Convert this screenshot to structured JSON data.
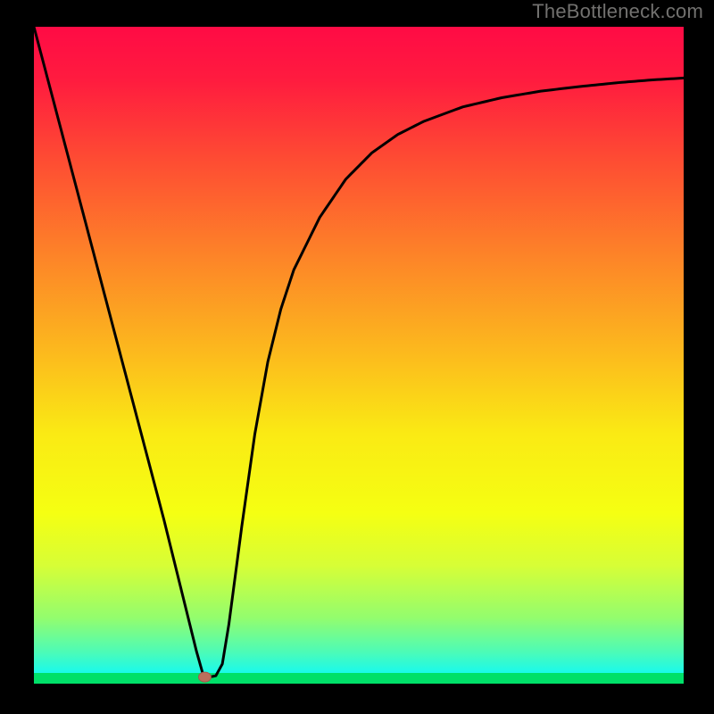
{
  "attribution": "TheBottleneck.com",
  "colors": {
    "curve": "#000000",
    "marker_fill": "#bb6f5d",
    "marker_stroke": "#a4584f"
  },
  "chart_data": {
    "type": "line",
    "title": "",
    "xlabel": "",
    "ylabel": "",
    "xlim": [
      0,
      100
    ],
    "ylim": [
      0,
      100
    ],
    "curve": {
      "x": [
        0,
        2,
        4,
        6,
        8,
        10,
        12,
        14,
        16,
        18,
        20,
        21,
        22,
        23,
        24,
        25,
        26,
        27,
        28,
        29,
        30,
        32,
        34,
        36,
        38,
        40,
        44,
        48,
        52,
        56,
        60,
        66,
        72,
        78,
        84,
        90,
        95,
        100
      ],
      "y": [
        100,
        92.5,
        85,
        77.5,
        70,
        62.5,
        55,
        47.5,
        40,
        32.5,
        25,
        21,
        17,
        13,
        9,
        5,
        1.5,
        1,
        1.2,
        3,
        9,
        24,
        38,
        49,
        57,
        63,
        71,
        76.8,
        80.8,
        83.6,
        85.6,
        87.8,
        89.2,
        90.2,
        90.9,
        91.5,
        91.9,
        92.2
      ]
    },
    "marker": {
      "x": 26.3,
      "y": 1
    }
  }
}
